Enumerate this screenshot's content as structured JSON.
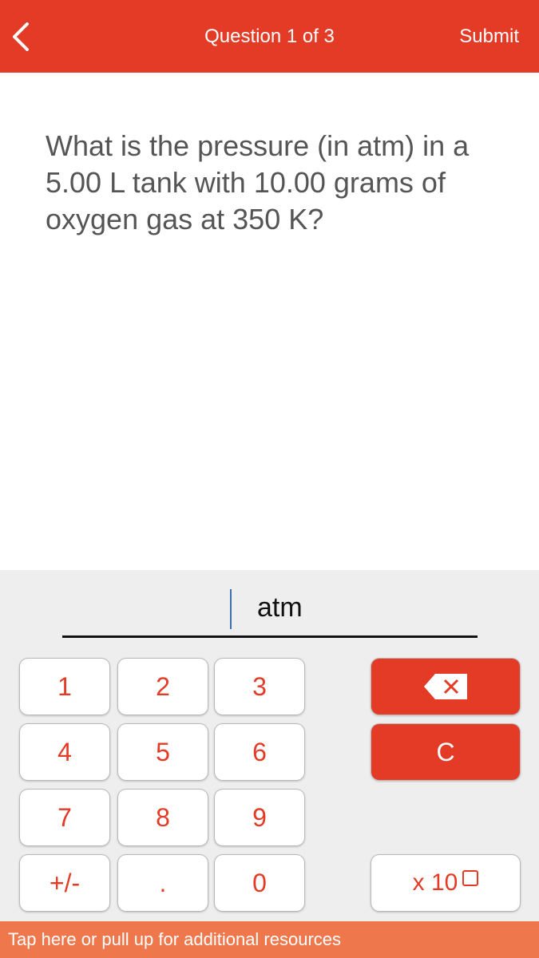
{
  "header": {
    "back_icon": "chevron-left-icon",
    "title": "Question 1 of 3",
    "submit_label": "Submit"
  },
  "question": {
    "text": "What is the pressure (in atm) in a 5.00 L tank with 10.00 grams of oxygen gas at 350 K?"
  },
  "answer": {
    "value": "",
    "unit": "atm"
  },
  "keypad": {
    "keys": [
      "1",
      "2",
      "3",
      "4",
      "5",
      "6",
      "7",
      "8",
      "9",
      "+/-",
      ".",
      "0"
    ],
    "backspace_icon": "backspace-icon",
    "clear_label": "C",
    "exponent_label": "x 10"
  },
  "colors": {
    "primary": "#e33b26",
    "footer": "#ef774c",
    "keypad_bg": "#eeeeee"
  },
  "footer": {
    "text": "Tap here or pull up for additional resources"
  }
}
